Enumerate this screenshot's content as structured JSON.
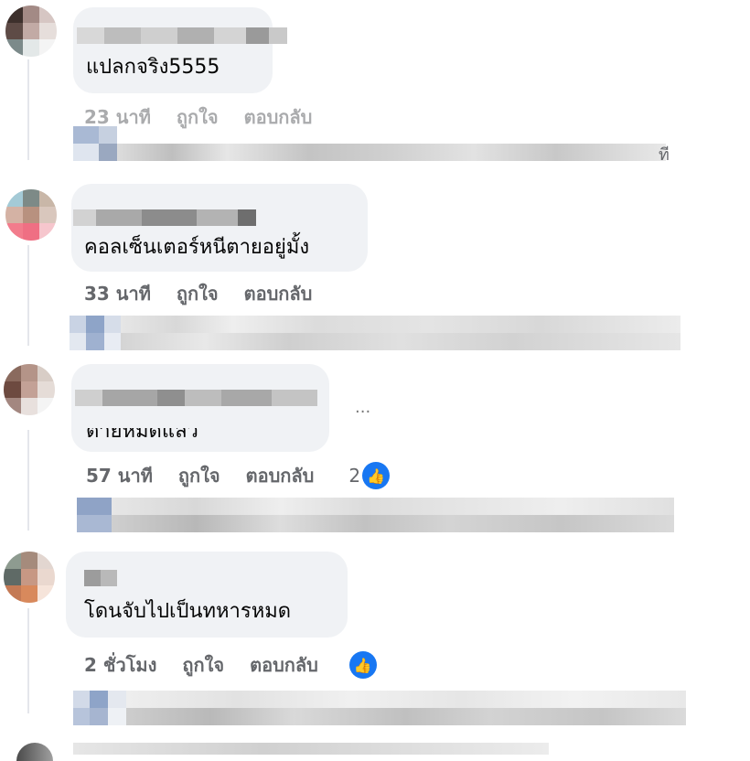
{
  "comments": [
    {
      "text": "แปลกจริง5555",
      "time": "23 นาที",
      "like": "ถูกใจ",
      "reply": "ตอบกลับ",
      "reply_hint": "ที"
    },
    {
      "text": "คอลเซ็นเตอร์หนีตายอยู่มั้ง",
      "time": "33 นาที",
      "like": "ถูกใจ",
      "reply": "ตอบกลับ"
    },
    {
      "text": "ตายหมดแล้ว",
      "time": "57 นาที",
      "like": "ถูกใจ",
      "reply": "ตอบกลับ",
      "reaction_count": "2",
      "trail": "..."
    },
    {
      "text": "โดนจับไปเป็นทหารหมด",
      "time": "2 ชั่วโมง",
      "like": "ถูกใจ",
      "reply": "ตอบกลับ"
    }
  ],
  "colors": {
    "bubble": "#f0f2f5",
    "meta": "#65676b",
    "like_blue": "#1877f2"
  },
  "icons": {
    "like": "thumbs-up-icon"
  }
}
